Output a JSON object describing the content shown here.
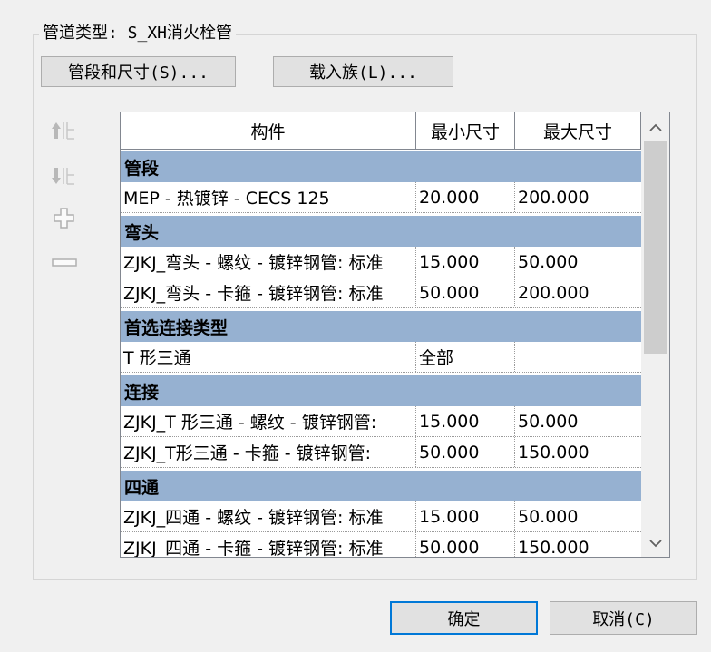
{
  "group": {
    "title": "管道类型: S_XH消火栓管"
  },
  "buttons": {
    "segments_sizes": "管段和尺寸(S)...",
    "load_family": "载入族(L)...",
    "ok": "确定",
    "cancel": "取消(C)"
  },
  "side_tools": {
    "move_up_icon": "arrow-up-icon",
    "move_down_icon": "arrow-down-icon",
    "add_icon": "plus-icon",
    "remove_icon": "minus-icon"
  },
  "table": {
    "headers": {
      "component": "构件",
      "min_size": "最小尺寸",
      "max_size": "最大尺寸"
    },
    "groups": [
      {
        "label": "管段",
        "rows": [
          {
            "component": "MEP - 热镀锌 - CECS 125",
            "min": "20.000",
            "max": "200.000"
          }
        ]
      },
      {
        "label": "弯头",
        "rows": [
          {
            "component": "ZJKJ_弯头 - 螺纹 - 镀锌钢管: 标准",
            "min": "15.000",
            "max": "50.000"
          },
          {
            "component": "ZJKJ_弯头 - 卡箍 - 镀锌钢管: 标准",
            "min": "50.000",
            "max": "200.000"
          }
        ]
      },
      {
        "label": "首选连接类型",
        "rows": [
          {
            "component": "T 形三通",
            "min": "全部",
            "max": ""
          }
        ]
      },
      {
        "label": "连接",
        "rows": [
          {
            "component": "ZJKJ_T 形三通 - 螺纹 - 镀锌钢管:",
            "min": "15.000",
            "max": "50.000"
          },
          {
            "component": "ZJKJ_T形三通 - 卡箍 - 镀锌钢管:",
            "min": "50.000",
            "max": "150.000"
          }
        ]
      },
      {
        "label": "四通",
        "rows": [
          {
            "component": "ZJKJ_四通 - 螺纹 - 镀锌钢管: 标准",
            "min": "15.000",
            "max": "50.000"
          },
          {
            "component": "ZJKJ_四通 - 卡箍 - 镀锌钢管: 标准",
            "min": "50.000",
            "max": "150.000"
          }
        ]
      }
    ]
  },
  "colors": {
    "group_row_bg": "#96b1d1",
    "accent_border": "#0078d7"
  }
}
